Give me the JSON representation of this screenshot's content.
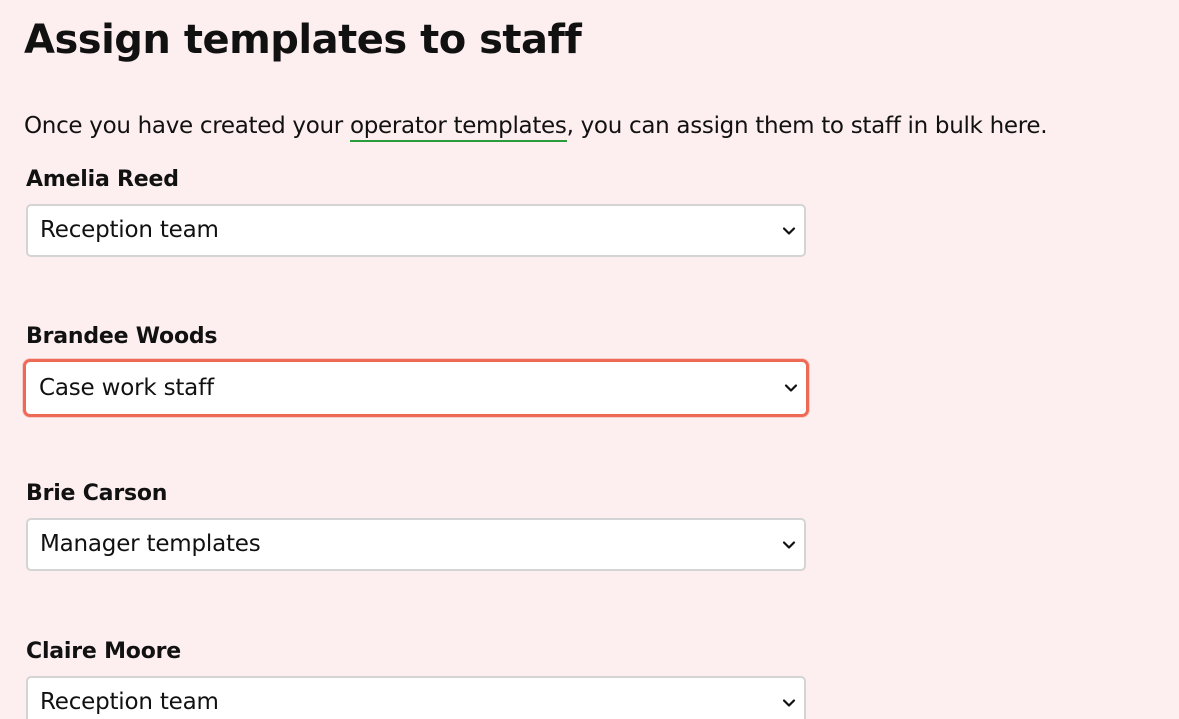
{
  "page": {
    "title": "Assign templates to staff",
    "intro_before": "Once you have created your ",
    "intro_link": "operator templates",
    "intro_after": ", you can assign them to staff in bulk here."
  },
  "staff": [
    {
      "name": "Amelia Reed",
      "template": "Reception team",
      "focused": false
    },
    {
      "name": "Brandee Woods",
      "template": "Case work staff",
      "focused": true
    },
    {
      "name": "Brie Carson",
      "template": "Manager templates",
      "focused": false
    },
    {
      "name": "Claire Moore",
      "template": "Reception team",
      "focused": false
    }
  ],
  "icons": {
    "select_arrow": "chevron-down-icon"
  },
  "colors": {
    "background": "#fdeef0",
    "link_underline": "#2a9d3a",
    "focus_ring": "#ef6a55",
    "select_border": "#d4d4d4"
  }
}
